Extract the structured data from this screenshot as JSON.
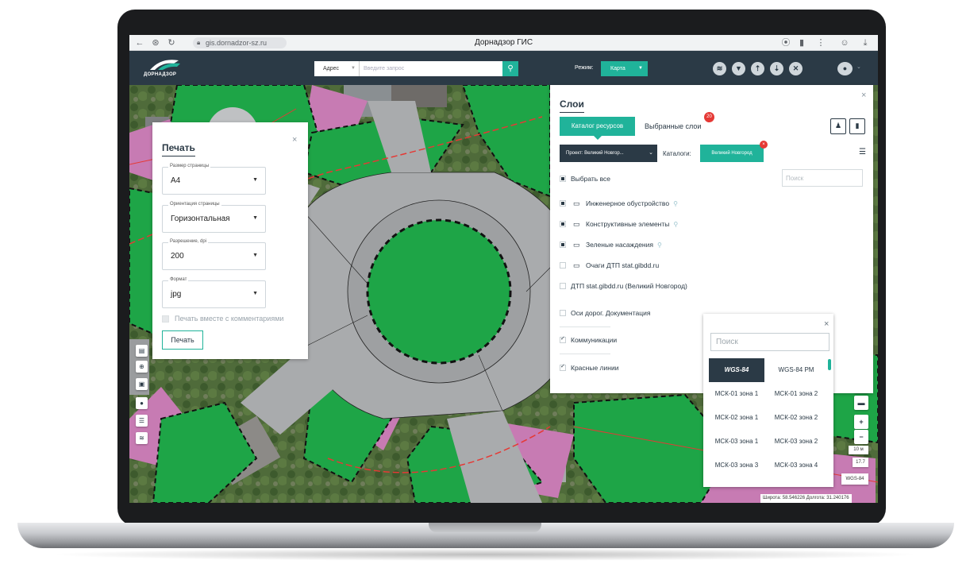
{
  "browser": {
    "title": "Дорнадзор ГИС",
    "url": "gis.dornadzor-sz.ru",
    "icons": [
      "back-arrow-icon",
      "forward-arrow-icon",
      "reload-icon",
      "lock-icon",
      "location-icon",
      "bookmark-icon",
      "more-icon",
      "profile-icon",
      "download-icon"
    ]
  },
  "header": {
    "logo_text": "ДОРНАДЗОР",
    "search_type": "Адрес",
    "search_placeholder": "Введите запрос",
    "mode_label": "Режим:",
    "mode_value": "Карта",
    "tools": [
      "layers-icon",
      "filter-icon",
      "upload-icon",
      "download-icon",
      "tools-icon"
    ],
    "accent_color": "#20b39a",
    "header_color": "#2b3a46"
  },
  "print": {
    "title": "Печать",
    "close": "×",
    "fields": [
      {
        "label": "Размер страницы",
        "value": "А4"
      },
      {
        "label": "Ориентация страницы",
        "value": "Горизонтальная"
      },
      {
        "label": "Разрешение, dpi",
        "value": "200"
      },
      {
        "label": "Формат",
        "value": "jpg"
      }
    ],
    "comments_label": "Печать вместе с комментариями",
    "print_button": "Печать"
  },
  "layers": {
    "title": "Слои",
    "close": "×",
    "tab_catalog": "Каталог ресурсов",
    "tab_selected": "Выбранные слои",
    "selected_count": "20",
    "project": "Проект: Великий Новгор...",
    "catalogs_label": "Каталоги:",
    "catalog_chip": "Великий Новгород",
    "chip_remove": "×",
    "search_placeholder": "Поиск",
    "select_all": "Выбрать все",
    "items": [
      {
        "label": "Инженерное обустройство",
        "state": "partial",
        "folder": true,
        "zoom": true
      },
      {
        "label": "Конструктивные элементы",
        "state": "partial",
        "folder": true,
        "zoom": true
      },
      {
        "label": "Зеленые насаждения",
        "state": "partial",
        "folder": true,
        "zoom": true
      },
      {
        "label": "Очаги ДТП stat.gibdd.ru",
        "state": "empty",
        "folder": true,
        "zoom": false
      },
      {
        "label": "ДТП stat.gibdd.ru (Великий Новгород)",
        "state": "empty",
        "folder": false,
        "zoom": false
      },
      {
        "label": "Оси дорог. Документация",
        "state": "empty",
        "folder": false,
        "zoom": false
      },
      {
        "label": "Коммуникации",
        "state": "checked",
        "folder": false,
        "zoom": false
      },
      {
        "label": "Красные линии",
        "state": "checked",
        "folder": false,
        "zoom": false
      }
    ]
  },
  "crs": {
    "close": "×",
    "search_placeholder": "Поиск",
    "items": [
      "WGS-84",
      "WGS-84 PM",
      "МСК-01 зона 1",
      "МСК-01 зона 2",
      "МСК-02 зона 1",
      "МСК-02 зона 2",
      "МСК-03 зона 1",
      "МСК-03 зона 2",
      "МСК-03 зона 3",
      "МСК-03 зона 4"
    ],
    "active": "WGS-84"
  },
  "map_controls": {
    "scale_text": "10 м",
    "zoom_level": "17.7",
    "crs_label": "WGS-84",
    "coordinates": "Широта: 58.546226  Долгота: 31.240176"
  }
}
